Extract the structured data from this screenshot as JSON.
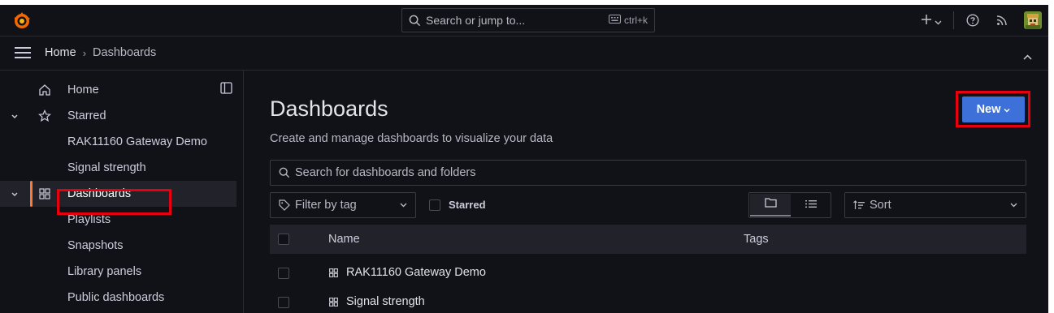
{
  "topbar": {
    "search_placeholder": "Search or jump to...",
    "shortcut": "ctrl+k"
  },
  "breadcrumb": {
    "home": "Home",
    "separator": "›",
    "current": "Dashboards"
  },
  "sidebar": {
    "items": [
      {
        "label": "Home",
        "icon": "home-icon"
      },
      {
        "label": "Starred",
        "icon": "star-icon"
      },
      {
        "label": "RAK11160 Gateway Demo"
      },
      {
        "label": "Signal strength"
      },
      {
        "label": "Dashboards",
        "icon": "apps-icon",
        "active": true
      },
      {
        "label": "Playlists"
      },
      {
        "label": "Snapshots"
      },
      {
        "label": "Library panels"
      },
      {
        "label": "Public dashboards"
      }
    ]
  },
  "main": {
    "title": "Dashboards",
    "subtitle": "Create and manage dashboards to visualize your data",
    "new_label": "New",
    "search_placeholder": "Search for dashboards and folders",
    "filter_tag_label": "Filter by tag",
    "starred_label": "Starred",
    "sort_label": "Sort",
    "table": {
      "headers": [
        "Name",
        "Tags"
      ],
      "rows": [
        {
          "name": "RAK11160 Gateway Demo"
        },
        {
          "name": "Signal strength"
        }
      ]
    }
  },
  "colors": {
    "background": "#111217",
    "accent_blue": "#3d71d9",
    "active_orange": "#ff7731",
    "highlight_red": "#e8000f"
  }
}
